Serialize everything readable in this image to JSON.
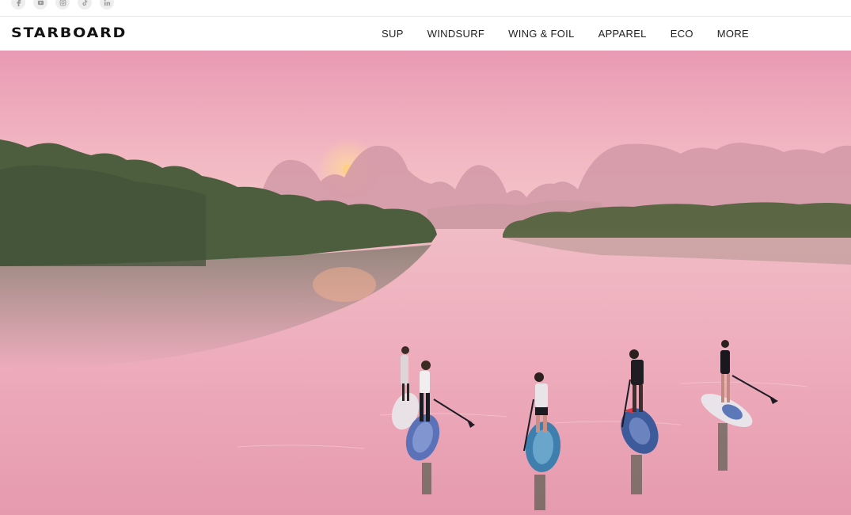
{
  "brand": {
    "logo_text": "STARBOARD"
  },
  "social": {
    "icons": [
      "facebook-icon",
      "youtube-icon",
      "instagram-icon",
      "tiktok-icon",
      "linkedin-icon"
    ]
  },
  "nav": {
    "items": [
      {
        "label": "SUP"
      },
      {
        "label": "WINDSURF"
      },
      {
        "label": "WING & FOIL"
      },
      {
        "label": "APPAREL"
      },
      {
        "label": "ECO"
      },
      {
        "label": "MORE"
      }
    ]
  },
  "hero": {
    "image": "sunset-lagoon-paddleboarders"
  },
  "colors": {
    "sky_top": "#eb9fb6",
    "sky_low": "#f4c2c7",
    "water": "#ecaaba",
    "forest": "#4a5b3c",
    "text": "#222222"
  }
}
